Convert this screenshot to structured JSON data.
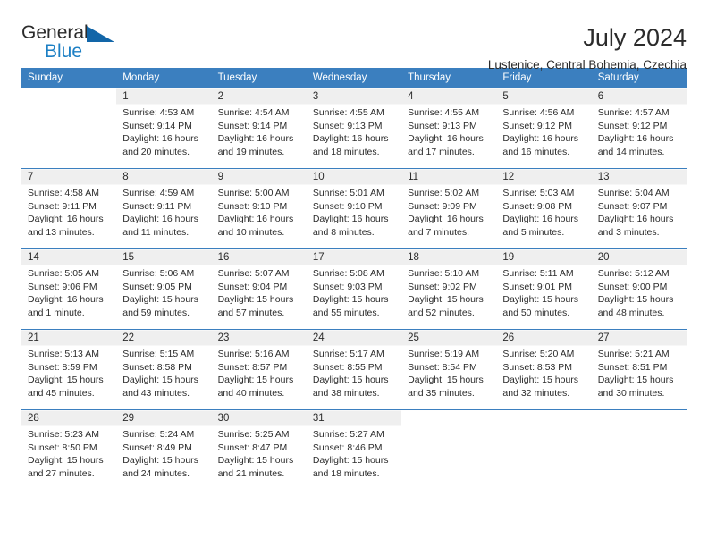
{
  "brand": {
    "name_top": "General",
    "name_bottom": "Blue",
    "accent_color": "#1c7fc4",
    "triangle_color": "#1266a8"
  },
  "header": {
    "title": "July 2024",
    "location": "Lustenice, Central Bohemia, Czechia"
  },
  "theme": {
    "header_bar_color": "#3b7fbf",
    "daynum_band_color": "#efefef",
    "text_color": "#2b2b2b"
  },
  "weekday_headers": [
    "Sunday",
    "Monday",
    "Tuesday",
    "Wednesday",
    "Thursday",
    "Friday",
    "Saturday"
  ],
  "weeks": [
    [
      {
        "day": ""
      },
      {
        "day": "1",
        "sunrise": "Sunrise: 4:53 AM",
        "sunset": "Sunset: 9:14 PM",
        "daylight_1": "Daylight: 16 hours",
        "daylight_2": "and 20 minutes."
      },
      {
        "day": "2",
        "sunrise": "Sunrise: 4:54 AM",
        "sunset": "Sunset: 9:14 PM",
        "daylight_1": "Daylight: 16 hours",
        "daylight_2": "and 19 minutes."
      },
      {
        "day": "3",
        "sunrise": "Sunrise: 4:55 AM",
        "sunset": "Sunset: 9:13 PM",
        "daylight_1": "Daylight: 16 hours",
        "daylight_2": "and 18 minutes."
      },
      {
        "day": "4",
        "sunrise": "Sunrise: 4:55 AM",
        "sunset": "Sunset: 9:13 PM",
        "daylight_1": "Daylight: 16 hours",
        "daylight_2": "and 17 minutes."
      },
      {
        "day": "5",
        "sunrise": "Sunrise: 4:56 AM",
        "sunset": "Sunset: 9:12 PM",
        "daylight_1": "Daylight: 16 hours",
        "daylight_2": "and 16 minutes."
      },
      {
        "day": "6",
        "sunrise": "Sunrise: 4:57 AM",
        "sunset": "Sunset: 9:12 PM",
        "daylight_1": "Daylight: 16 hours",
        "daylight_2": "and 14 minutes."
      }
    ],
    [
      {
        "day": "7",
        "sunrise": "Sunrise: 4:58 AM",
        "sunset": "Sunset: 9:11 PM",
        "daylight_1": "Daylight: 16 hours",
        "daylight_2": "and 13 minutes."
      },
      {
        "day": "8",
        "sunrise": "Sunrise: 4:59 AM",
        "sunset": "Sunset: 9:11 PM",
        "daylight_1": "Daylight: 16 hours",
        "daylight_2": "and 11 minutes."
      },
      {
        "day": "9",
        "sunrise": "Sunrise: 5:00 AM",
        "sunset": "Sunset: 9:10 PM",
        "daylight_1": "Daylight: 16 hours",
        "daylight_2": "and 10 minutes."
      },
      {
        "day": "10",
        "sunrise": "Sunrise: 5:01 AM",
        "sunset": "Sunset: 9:10 PM",
        "daylight_1": "Daylight: 16 hours",
        "daylight_2": "and 8 minutes."
      },
      {
        "day": "11",
        "sunrise": "Sunrise: 5:02 AM",
        "sunset": "Sunset: 9:09 PM",
        "daylight_1": "Daylight: 16 hours",
        "daylight_2": "and 7 minutes."
      },
      {
        "day": "12",
        "sunrise": "Sunrise: 5:03 AM",
        "sunset": "Sunset: 9:08 PM",
        "daylight_1": "Daylight: 16 hours",
        "daylight_2": "and 5 minutes."
      },
      {
        "day": "13",
        "sunrise": "Sunrise: 5:04 AM",
        "sunset": "Sunset: 9:07 PM",
        "daylight_1": "Daylight: 16 hours",
        "daylight_2": "and 3 minutes."
      }
    ],
    [
      {
        "day": "14",
        "sunrise": "Sunrise: 5:05 AM",
        "sunset": "Sunset: 9:06 PM",
        "daylight_1": "Daylight: 16 hours",
        "daylight_2": "and 1 minute."
      },
      {
        "day": "15",
        "sunrise": "Sunrise: 5:06 AM",
        "sunset": "Sunset: 9:05 PM",
        "daylight_1": "Daylight: 15 hours",
        "daylight_2": "and 59 minutes."
      },
      {
        "day": "16",
        "sunrise": "Sunrise: 5:07 AM",
        "sunset": "Sunset: 9:04 PM",
        "daylight_1": "Daylight: 15 hours",
        "daylight_2": "and 57 minutes."
      },
      {
        "day": "17",
        "sunrise": "Sunrise: 5:08 AM",
        "sunset": "Sunset: 9:03 PM",
        "daylight_1": "Daylight: 15 hours",
        "daylight_2": "and 55 minutes."
      },
      {
        "day": "18",
        "sunrise": "Sunrise: 5:10 AM",
        "sunset": "Sunset: 9:02 PM",
        "daylight_1": "Daylight: 15 hours",
        "daylight_2": "and 52 minutes."
      },
      {
        "day": "19",
        "sunrise": "Sunrise: 5:11 AM",
        "sunset": "Sunset: 9:01 PM",
        "daylight_1": "Daylight: 15 hours",
        "daylight_2": "and 50 minutes."
      },
      {
        "day": "20",
        "sunrise": "Sunrise: 5:12 AM",
        "sunset": "Sunset: 9:00 PM",
        "daylight_1": "Daylight: 15 hours",
        "daylight_2": "and 48 minutes."
      }
    ],
    [
      {
        "day": "21",
        "sunrise": "Sunrise: 5:13 AM",
        "sunset": "Sunset: 8:59 PM",
        "daylight_1": "Daylight: 15 hours",
        "daylight_2": "and 45 minutes."
      },
      {
        "day": "22",
        "sunrise": "Sunrise: 5:15 AM",
        "sunset": "Sunset: 8:58 PM",
        "daylight_1": "Daylight: 15 hours",
        "daylight_2": "and 43 minutes."
      },
      {
        "day": "23",
        "sunrise": "Sunrise: 5:16 AM",
        "sunset": "Sunset: 8:57 PM",
        "daylight_1": "Daylight: 15 hours",
        "daylight_2": "and 40 minutes."
      },
      {
        "day": "24",
        "sunrise": "Sunrise: 5:17 AM",
        "sunset": "Sunset: 8:55 PM",
        "daylight_1": "Daylight: 15 hours",
        "daylight_2": "and 38 minutes."
      },
      {
        "day": "25",
        "sunrise": "Sunrise: 5:19 AM",
        "sunset": "Sunset: 8:54 PM",
        "daylight_1": "Daylight: 15 hours",
        "daylight_2": "and 35 minutes."
      },
      {
        "day": "26",
        "sunrise": "Sunrise: 5:20 AM",
        "sunset": "Sunset: 8:53 PM",
        "daylight_1": "Daylight: 15 hours",
        "daylight_2": "and 32 minutes."
      },
      {
        "day": "27",
        "sunrise": "Sunrise: 5:21 AM",
        "sunset": "Sunset: 8:51 PM",
        "daylight_1": "Daylight: 15 hours",
        "daylight_2": "and 30 minutes."
      }
    ],
    [
      {
        "day": "28",
        "sunrise": "Sunrise: 5:23 AM",
        "sunset": "Sunset: 8:50 PM",
        "daylight_1": "Daylight: 15 hours",
        "daylight_2": "and 27 minutes."
      },
      {
        "day": "29",
        "sunrise": "Sunrise: 5:24 AM",
        "sunset": "Sunset: 8:49 PM",
        "daylight_1": "Daylight: 15 hours",
        "daylight_2": "and 24 minutes."
      },
      {
        "day": "30",
        "sunrise": "Sunrise: 5:25 AM",
        "sunset": "Sunset: 8:47 PM",
        "daylight_1": "Daylight: 15 hours",
        "daylight_2": "and 21 minutes."
      },
      {
        "day": "31",
        "sunrise": "Sunrise: 5:27 AM",
        "sunset": "Sunset: 8:46 PM",
        "daylight_1": "Daylight: 15 hours",
        "daylight_2": "and 18 minutes."
      },
      {
        "day": ""
      },
      {
        "day": ""
      },
      {
        "day": ""
      }
    ]
  ]
}
